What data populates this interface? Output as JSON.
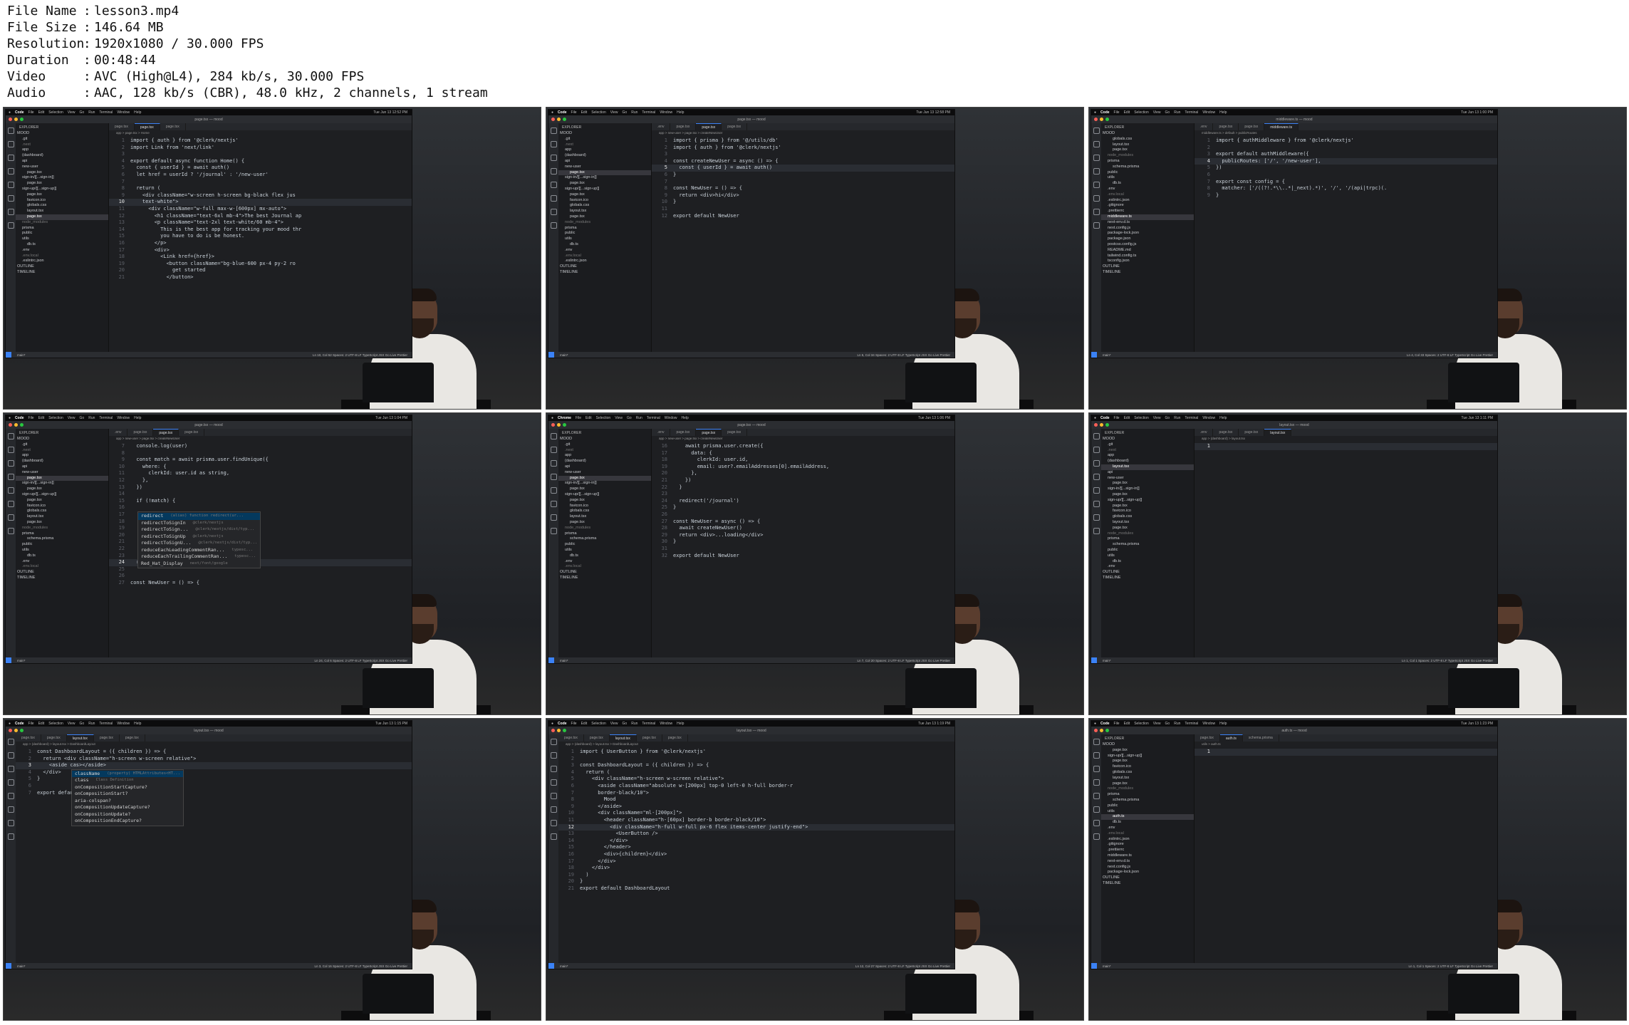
{
  "info": [
    {
      "key": "File Name",
      "value": "lesson3.mp4"
    },
    {
      "key": "File Size",
      "value": "146.64 MB"
    },
    {
      "key": "Resolution",
      "value": "1920x1080 / 30.000 FPS"
    },
    {
      "key": "Duration",
      "value": "00:48:44"
    },
    {
      "key": "Video",
      "value": "AVC (High@L4), 284 kb/s, 30.000 FPS"
    },
    {
      "key": "Audio",
      "value": "AAC, 128 kb/s (CBR), 48.0 kHz, 2 channels, 1 stream"
    }
  ],
  "frames": [
    {
      "menu_app": "Code",
      "clock": "Tue Jun 13 12:52 PM",
      "window_title": "page.tsx — mood",
      "tabs": [
        "page.tsx",
        "page.tsx",
        "page.tsx"
      ],
      "active_tab": 1,
      "breadcrumb": "app > page.tsx > Home",
      "explorer_title": "EXPLORER",
      "tree": [
        "MOOD",
        ".git",
        ".next",
        "app",
        "(dashboard)",
        "api",
        "new-user",
        "page.tsx",
        "sign-in/[[...sign-in]]",
        "page.tsx",
        "sign-up/[[...sign-up]]",
        "page.tsx",
        "favicon.ico",
        "globals.css",
        "layout.tsx",
        "page.tsx",
        "node_modules",
        "prisma",
        "public",
        "utils",
        "db.ts",
        ".env",
        ".env.local",
        ".eslintrc.json",
        "OUTLINE",
        "TIMELINE"
      ],
      "selected_tree": 15,
      "code_start": 1,
      "current_line": 10,
      "code": [
        "import { auth } from '@clerk/nextjs'",
        "import Link from 'next/link'",
        "",
        "export default async function Home() {",
        "  const { userId } = await auth()",
        "  let href = userId ? '/journal' : '/new-user'",
        "",
        "  return (",
        "    <div className=\"w-screen h-screen bg-black flex jus",
        "    text-white\">",
        "      <div className=\"w-full max-w-[600px] mx-auto\">",
        "        <h1 className=\"text-6xl mb-4\">The best Journal ap",
        "        <p className=\"text-2xl text-white/60 mb-4\">",
        "          This is the best app for tracking your mood thr",
        "          you have to do is be honest.",
        "        </p>",
        "        <div>",
        "          <Link href={href}>",
        "            <button className=\"bg-blue-600 px-4 py-2 ro",
        "              get started",
        "            </button>"
      ],
      "status": "Ln 10, Col 52   Spaces: 2   UTF-8   LF   TypeScript JSX   Go Live   Prettier"
    },
    {
      "menu_app": "Code",
      "clock": "Tue Jun 13 12:58 PM",
      "window_title": "page.tsx — mood",
      "tabs": [
        ".env",
        "page.tsx",
        "page.tsx",
        "page.tsx"
      ],
      "active_tab": 2,
      "breadcrumb": "app > new-user > page.tsx > createNewUser",
      "explorer_title": "EXPLORER",
      "tree": [
        "MOOD",
        ".git",
        ".next",
        "app",
        "(dashboard)",
        "api",
        "new-user",
        "page.tsx",
        "sign-in/[[...sign-in]]",
        "page.tsx",
        "sign-up/[[...sign-up]]",
        "page.tsx",
        "favicon.ico",
        "globals.css",
        "layout.tsx",
        "page.tsx",
        "node_modules",
        "prisma",
        "public",
        "utils",
        "db.ts",
        ".env",
        ".env.local",
        ".eslintrc.json",
        "OUTLINE",
        "TIMELINE"
      ],
      "selected_tree": 7,
      "code_start": 1,
      "current_line": 5,
      "code": [
        "import { prisma } from '@/utils/db'",
        "import { auth } from '@clerk/nextjs'",
        "",
        "const createNewUser = async () => {",
        "  const { userId } = await auth()",
        "}",
        "",
        "const NewUser = () => {",
        "  return <div>hi</div>",
        "}",
        "",
        "export default NewUser"
      ],
      "status": "Ln 5, Col 34   Spaces: 2   UTF-8   LF   TypeScript JSX   Go Live   Prettier"
    },
    {
      "menu_app": "Code",
      "clock": "Tue Jun 13 1:00 PM",
      "window_title": "middleware.ts — mood",
      "tabs": [
        ".env",
        "page.tsx",
        "page.tsx",
        "middleware.ts"
      ],
      "active_tab": 3,
      "breadcrumb": "middleware.ts > default > publicRoutes",
      "explorer_title": "EXPLORER",
      "tree": [
        "MOOD",
        "globals.css",
        "layout.tsx",
        "page.tsx",
        "node_modules",
        "prisma",
        "schema.prisma",
        "public",
        "utils",
        "db.ts",
        ".env",
        ".env.local",
        ".eslintrc.json",
        ".gitignore",
        ".prettierrc",
        "middleware.ts",
        "next-env.d.ts",
        "next.config.js",
        "package-lock.json",
        "package.json",
        "postcss.config.js",
        "README.md",
        "tailwind.config.ts",
        "tsconfig.json",
        "OUTLINE",
        "TIMELINE"
      ],
      "selected_tree": 15,
      "code_start": 1,
      "current_line": 4,
      "code": [
        "import { authMiddleware } from '@clerk/nextjs'",
        "",
        "export default authMiddleware({",
        "  publicRoutes: ['/', '/new-user'],",
        "})",
        "",
        "export const config = {",
        "  matcher: ['/((?!.*\\\\..*|_next).*)', '/', '/(api|trpc)(.",
        "}"
      ],
      "status": "Ln 4, Col 33   Spaces: 2   UTF-8   LF   TypeScript   Go Live   Prettier"
    },
    {
      "menu_app": "Code",
      "clock": "Tue Jun 13 1:04 PM",
      "window_title": "page.tsx — mood",
      "tabs": [
        ".env",
        "page.tsx",
        "page.tsx",
        "page.tsx"
      ],
      "active_tab": 2,
      "breadcrumb": "app > new-user > page.tsx > createNewUser",
      "explorer_title": "EXPLORER",
      "tree": [
        "MOOD",
        ".git",
        ".next",
        "app",
        "(dashboard)",
        "api",
        "new-user",
        "page.tsx",
        "sign-in/[[...sign-in]]",
        "page.tsx",
        "sign-up/[[...sign-up]]",
        "page.tsx",
        "favicon.ico",
        "globals.css",
        "layout.tsx",
        "page.tsx",
        "node_modules",
        "prisma",
        "schema.prisma",
        "public",
        "utils",
        "db.ts",
        ".env",
        ".env.local",
        "OUTLINE",
        "TIMELINE"
      ],
      "selected_tree": 7,
      "code_start": 7,
      "current_line": 24,
      "code": [
        "  console.log(user)",
        "",
        "  const match = await prisma.user.findUnique({",
        "    where: {",
        "      clerkId: user.id as string,",
        "    },",
        "  })",
        "",
        "  if (!match) {",
        "",
        "",
        "",
        "",
        "",
        "",
        "",
        "",
        "  red",
        "",
        "",
        "const NewUser = () => {"
      ],
      "suggest": [
        {
          "label": "redirect",
          "hint": "(alias) function redirect(ur..."
        },
        {
          "label": "redirectToSignIn",
          "hint": "@clerk/nextjs"
        },
        {
          "label": "redirectToSign...",
          "hint": "@clerk/nextjs/dist/typ..."
        },
        {
          "label": "redirectToSignUp",
          "hint": "@clerk/nextjs"
        },
        {
          "label": "redirectToSignU...",
          "hint": "@clerk/nextjs/dist/typ..."
        },
        {
          "label": "reduceEachLeadingCommentRan...",
          "hint": "typesc..."
        },
        {
          "label": "reduceEachTrailingCommentRan...",
          "hint": "typesc..."
        },
        {
          "label": "Red_Hat_Display",
          "hint": "next/font/google"
        }
      ],
      "status": "Ln 24, Col 6   Spaces: 2   UTF-8   LF   TypeScript JSX   Go Live   Prettier"
    },
    {
      "menu_app": "Chrome",
      "clock": "Tue Jun 13 1:06 PM",
      "window_title": "page.tsx — mood",
      "tabs": [
        ".env",
        "page.tsx",
        "page.tsx",
        "page.tsx"
      ],
      "active_tab": 2,
      "breadcrumb": "app > new-user > page.tsx > createNewUser",
      "explorer_title": "EXPLORER",
      "tree": [
        "MOOD",
        ".git",
        ".next",
        "app",
        "(dashboard)",
        "api",
        "new-user",
        "page.tsx",
        "sign-in/[[...sign-in]]",
        "page.tsx",
        "sign-up/[[...sign-up]]",
        "page.tsx",
        "favicon.ico",
        "globals.css",
        "layout.tsx",
        "page.tsx",
        "node_modules",
        "prisma",
        "schema.prisma",
        "public",
        "utils",
        "db.ts",
        ".env",
        ".env.local",
        "OUTLINE",
        "TIMELINE"
      ],
      "selected_tree": 7,
      "code_start": 16,
      "current_line": 0,
      "code": [
        "    await prisma.user.create({",
        "      data: {",
        "        clerkId: user.id,",
        "        email: user?.emailAddresses[0].emailAddress,",
        "      },",
        "    })",
        "  }",
        "",
        "  redirect('/journal')",
        "}",
        "",
        "const NewUser = async () => {",
        "  await createNewUser()",
        "  return <div>...loading</div>",
        "}",
        "",
        "export default NewUser"
      ],
      "status": "Ln 7, Col 20   Spaces: 2   UTF-8   LF   TypeScript JSX   Go Live   Prettier"
    },
    {
      "menu_app": "Code",
      "clock": "Tue Jun 13 1:11 PM",
      "window_title": "layout.tsx — mood",
      "tabs": [
        ".env",
        "page.tsx",
        "page.tsx",
        "layout.tsx"
      ],
      "active_tab": 3,
      "breadcrumb": "app > (dashboard) > layout.tsx",
      "explorer_title": "EXPLORER",
      "tree": [
        "MOOD",
        ".git",
        ".next",
        "app",
        "(dashboard)",
        "layout.tsx",
        "api",
        "new-user",
        "page.tsx",
        "sign-in/[[...sign-in]]",
        "page.tsx",
        "sign-up/[[...sign-up]]",
        "page.tsx",
        "favicon.ico",
        "globals.css",
        "layout.tsx",
        "page.tsx",
        "node_modules",
        "prisma",
        "schema.prisma",
        "public",
        "utils",
        "db.ts",
        ".env",
        "OUTLINE",
        "TIMELINE"
      ],
      "selected_tree": 5,
      "code_start": 1,
      "current_line": 1,
      "code": [
        ""
      ],
      "status": "Ln 1, Col 1   Spaces: 2   UTF-8   LF   TypeScript JSX   Go Live   Prettier"
    },
    {
      "menu_app": "Code",
      "clock": "Tue Jun 13 1:15 PM",
      "window_title": "layout.tsx — mood",
      "tabs": [
        "page.tsx",
        "page.tsx",
        "layout.tsx",
        "page.tsx",
        "page.tsx"
      ],
      "active_tab": 2,
      "breadcrumb": "app > (dashboard) > layout.tsx > DashboardLayout",
      "explorer_title": "",
      "tree": [],
      "selected_tree": -1,
      "code_start": 1,
      "current_line": 3,
      "code": [
        "const DashboardLayout = ({ children }) => {",
        "  return <div className=\"h-screen w-screen relative\">",
        "    <aside cas></aside>",
        "  </div>",
        "}",
        "",
        "export default DashboardLayout"
      ],
      "suggest": [
        {
          "label": "className",
          "hint": "(property) HTMLAttributes<HT..."
        },
        {
          "label": "class",
          "hint": "Class Definition"
        },
        {
          "label": "onCompositionStartCapture?",
          "hint": ""
        },
        {
          "label": "onCompositionStart?",
          "hint": ""
        },
        {
          "label": "aria-colspan?",
          "hint": ""
        },
        {
          "label": "onCompositionUpdateCapture?",
          "hint": ""
        },
        {
          "label": "onCompositionUpdate?",
          "hint": ""
        },
        {
          "label": "onCompositionEndCapture?",
          "hint": ""
        }
      ],
      "status": "Ln 3, Col 16   Spaces: 2   UTF-8   LF   TypeScript JSX   Go Live   Prettier"
    },
    {
      "menu_app": "Code",
      "clock": "Tue Jun 13 1:19 PM",
      "window_title": "layout.tsx — mood",
      "tabs": [
        "page.tsx",
        "page.tsx",
        "layout.tsx",
        "page.tsx",
        "page.tsx"
      ],
      "active_tab": 2,
      "breadcrumb": "app > (dashboard) > layout.tsx > DashboardLayout",
      "explorer_title": "",
      "tree": [],
      "selected_tree": -1,
      "code_start": 1,
      "current_line": 12,
      "code": [
        "import { UserButton } from '@clerk/nextjs'",
        "",
        "const DashboardLayout = ({ children }) => {",
        "  return (",
        "    <div className=\"h-screen w-screen relative\">",
        "      <aside className=\"absolute w-[200px] top-0 left-0 h-full border-r",
        "      border-black/10\">",
        "        Mood",
        "      </aside>",
        "      <div className=\"ml-[200px]\">",
        "        <header className=\"h-[60px] border-b border-black/10\">",
        "          <div className=\"h-full w-full px-6 flex items-center justify-end\">",
        "            <UserButton />",
        "          </div>",
        "        </header>",
        "        <div>{children}</div>",
        "      </div>",
        "    </div>",
        "  )",
        "}",
        "export default DashboardLayout"
      ],
      "status": "Ln 12, Col 27   Spaces: 2   UTF-8   LF   TypeScript JSX   Go Live   Prettier"
    },
    {
      "menu_app": "Code",
      "clock": "Tue Jun 13 1:23 PM",
      "window_title": "auth.ts — mood",
      "tabs": [
        "page.tsx",
        "auth.ts",
        "schema.prisma"
      ],
      "active_tab": 1,
      "breadcrumb": "utils > auth.ts",
      "explorer_title": "EXPLORER",
      "tree": [
        "MOOD",
        "page.tsx",
        "sign-up/[[...sign-up]]",
        "page.tsx",
        "favicon.ico",
        "globals.css",
        "layout.tsx",
        "page.tsx",
        "node_modules",
        "prisma",
        "schema.prisma",
        "public",
        "utils",
        "auth.ts",
        "db.ts",
        ".env",
        ".env.local",
        ".eslintrc.json",
        ".gitignore",
        ".prettierrc",
        "middleware.ts",
        "next-env.d.ts",
        "next.config.js",
        "package-lock.json",
        "OUTLINE",
        "TIMELINE"
      ],
      "selected_tree": 13,
      "code_start": 1,
      "current_line": 1,
      "code": [
        ""
      ],
      "status": "Ln 1, Col 1   Spaces: 2   UTF-8   LF   TypeScript   Go Live   Prettier"
    }
  ]
}
